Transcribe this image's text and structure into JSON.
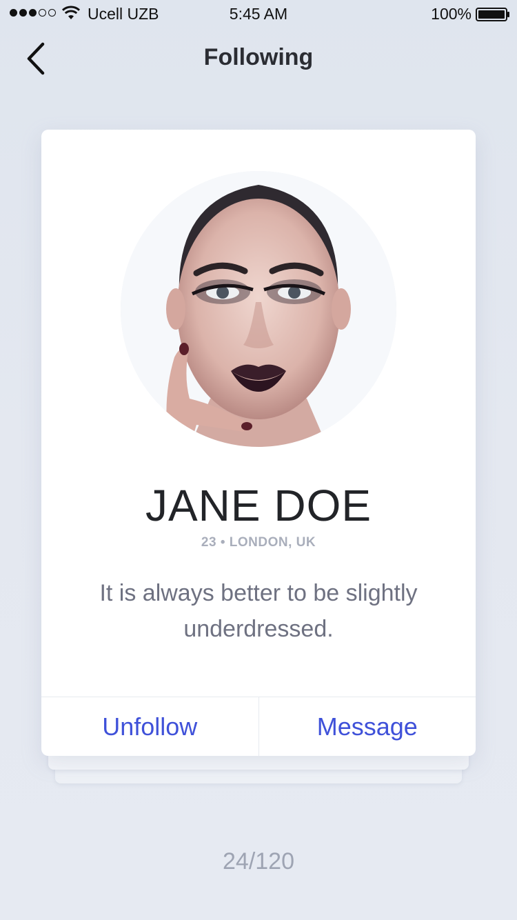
{
  "status_bar": {
    "carrier": "Ucell UZB",
    "time": "5:45 AM",
    "battery": "100%",
    "signal_bars_filled": 3,
    "signal_bars_total": 5
  },
  "nav": {
    "title": "Following",
    "back_icon": "chevron-left-icon"
  },
  "profile": {
    "name": "JANE DOE",
    "meta": "23 • LONDON, UK",
    "quote": "It is always better to be slightly underdressed."
  },
  "actions": {
    "unfollow_label": "Unfollow",
    "message_label": "Message"
  },
  "pager": {
    "label": "24/120"
  },
  "colors": {
    "accent": "#3f51d9",
    "background": "#e2e7ef",
    "card": "#ffffff",
    "text_primary": "#222428",
    "text_muted": "#a9aebb"
  }
}
